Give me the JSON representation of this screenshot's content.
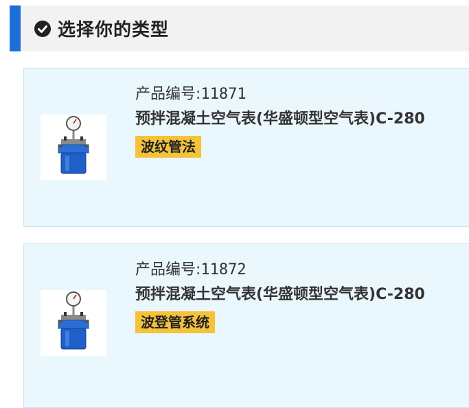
{
  "header": {
    "title": "选择你的类型",
    "accent_color": "#1d6fd8",
    "icon": "check-circle-icon"
  },
  "products": [
    {
      "code_label": "产品编号:",
      "code": "11871",
      "name": "预拌混凝土空气表(华盛顿型空气表)C-280",
      "tag": "波纹管法",
      "image": "air-meter-icon"
    },
    {
      "code_label": "产品编号:",
      "code": "11872",
      "name": "预拌混凝土空气表(华盛顿型空气表)C-280",
      "tag": "波登管系统",
      "image": "air-meter-icon"
    }
  ],
  "colors": {
    "card_background": "#eaf7fd",
    "tag_background": "#f4c33a"
  }
}
